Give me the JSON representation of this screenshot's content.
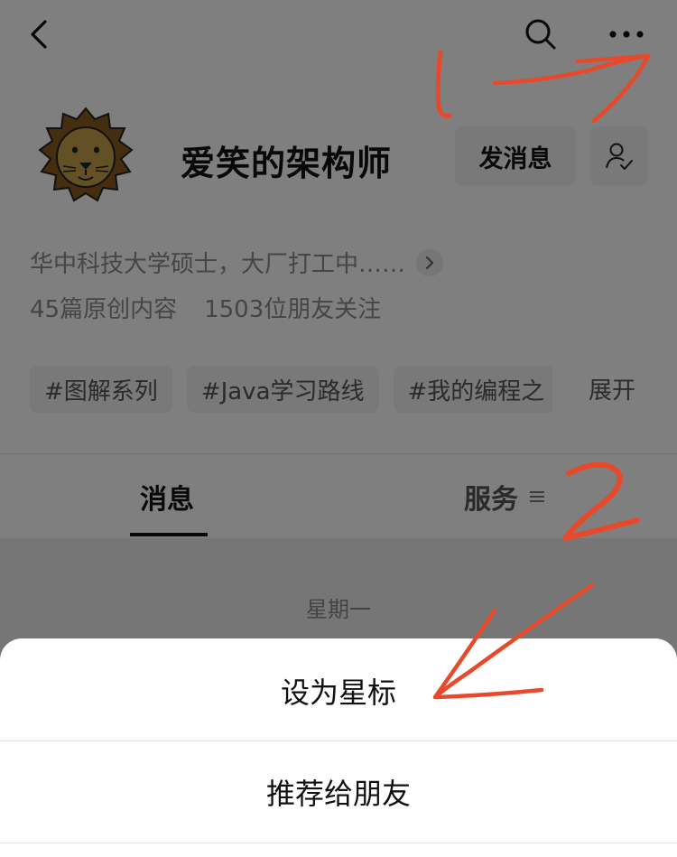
{
  "header": {
    "back_icon": "chevron-left-icon",
    "search_icon": "search-icon",
    "more_icon": "more-dots-icon"
  },
  "profile": {
    "avatar": "lion-avatar",
    "name": "爱笑的架构师",
    "send_message_label": "发消息",
    "follow_icon": "user-check-icon",
    "description": "华中科技大学硕士，大厂打工中……",
    "stats": {
      "original_content": "45篇原创内容",
      "followers": "1503位朋友关注"
    },
    "tags": [
      "#图解系列",
      "#Java学习路线",
      "#我的编程之"
    ],
    "expand_label": "展开"
  },
  "tabs": {
    "messages_label": "消息",
    "services_label": "服务"
  },
  "feed": {
    "date_label": "星期一"
  },
  "action_sheet": {
    "items": [
      "设为星标",
      "推荐给朋友"
    ]
  },
  "annotations": {
    "marks": [
      "1",
      "2"
    ],
    "color": "#e8492a"
  },
  "colors": {
    "overlay": "rgba(0,0,0,0.5)",
    "button_bg": "#f2f2f2",
    "secondary_text": "#8a8a8a"
  }
}
